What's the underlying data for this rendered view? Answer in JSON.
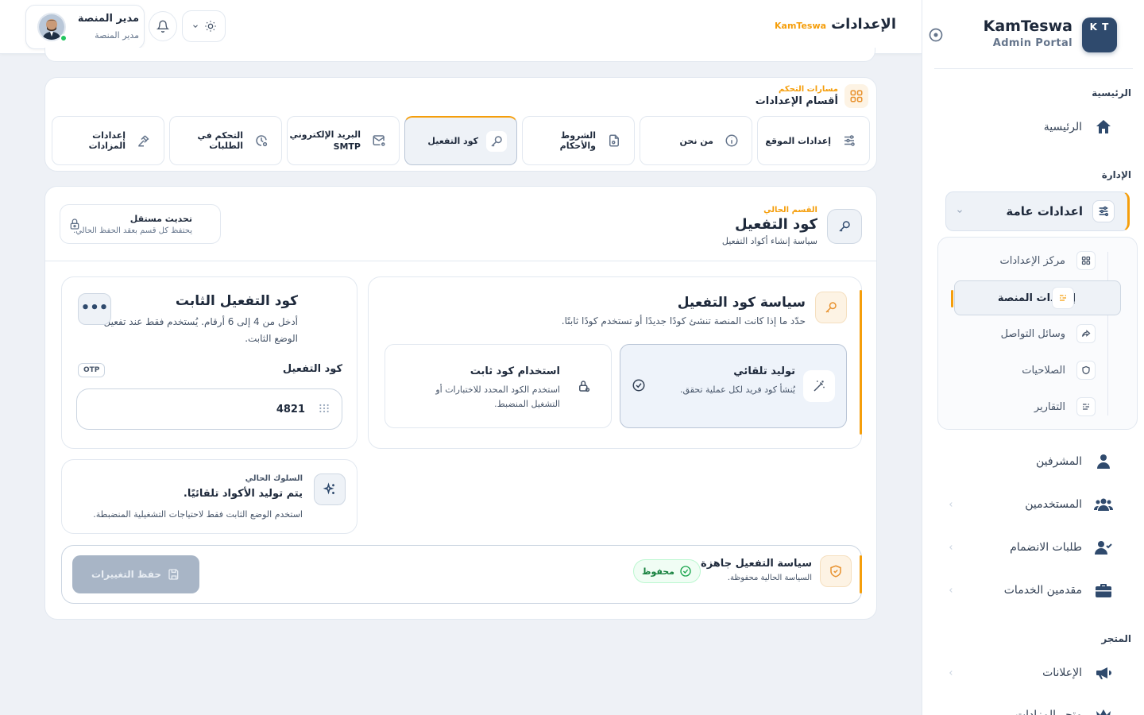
{
  "brand": {
    "logo_text": "K T",
    "name": "KamTeswa",
    "subtitle": "Admin Portal"
  },
  "sidebar": {
    "section_home": "الرئيسية",
    "home_label": "الرئيسية",
    "section_admin": "الإدارة",
    "general_settings_label": "اعدادات عامة",
    "sub_items": [
      {
        "label": "مركز الإعدادات"
      },
      {
        "label": "إعدادات المنصة"
      },
      {
        "label": "وسائل التواصل"
      },
      {
        "label": "الصلاحيات"
      },
      {
        "label": "التقارير"
      }
    ],
    "supervisors_label": "المشرفين",
    "users_label": "المستخدمين",
    "join_requests_label": "طلبات الانضمام",
    "providers_label": "مقدمين الخدمات",
    "section_store": "المتجر",
    "ads_label": "الإعلانات",
    "cut_label": "متجر المزادات"
  },
  "topbar": {
    "title": "الإعدادات",
    "brand_tag": "KamTeswa",
    "user_name": "مدير المنصة",
    "user_role": "مدير المنصة"
  },
  "section_nav": {
    "subtitle": "مسارات التحكم",
    "title": "أقسام الإعدادات",
    "tabs": [
      {
        "label": "إعدادات الموقع",
        "icon": "sliders-icon"
      },
      {
        "label": "من نحن",
        "icon": "info-icon"
      },
      {
        "label": "الشروط والأحكام",
        "icon": "document-icon"
      },
      {
        "label": "كود التفعيل",
        "icon": "key-icon"
      },
      {
        "label": "البريد الإلكتروني SMTP",
        "icon": "mail-settings-icon"
      },
      {
        "label": "التحكم في الطلبات",
        "icon": "clock-settings-icon"
      },
      {
        "label": "إعدادات المزادات",
        "icon": "gavel-icon"
      }
    ]
  },
  "content": {
    "eyebrow": "القسم الحالي",
    "title": "كود التفعيل",
    "description": "سياسة إنشاء أكواد التفعيل",
    "independent_title": "تحديث مستقل",
    "independent_desc": "يحتفظ كل قسم بعقد الحفظ الحالي."
  },
  "policy": {
    "title": "سياسة كود التفعيل",
    "description": "حدّد ما إذا كانت المنصة تنشئ كودًا جديدًا أو تستخدم كودًا ثابتًا.",
    "options": [
      {
        "title": "توليد تلقائي",
        "desc": "يُنشأ كود فريد لكل عملية تحقق.",
        "selected": true
      },
      {
        "title": "استخدام كود ثابت",
        "desc": "استخدم الكود المحدد للاختبارات أو التشغيل المنضبط.",
        "selected": false
      }
    ]
  },
  "fixed_code": {
    "title": "كود التفعيل الثابت",
    "description": "أدخل من 4 إلى 6 أرقام. يُستخدم فقط عند تفعيل الوضع الثابت.",
    "more": "•••",
    "field_label": "كود التفعيل",
    "badge": "OTP",
    "value": "4821"
  },
  "behavior": {
    "eyebrow": "السلوك الحالي",
    "title": "يتم توليد الأكواد تلقائيًا.",
    "desc": "استخدم الوضع الثابت فقط لاحتياجات التشغيلية المنضبطة."
  },
  "save_bar": {
    "title": "سياسة التفعيل جاهزة",
    "desc": "السياسة الحالية محفوظة.",
    "badge": "محفوظ",
    "button": "حفظ التغييرات"
  },
  "colors": {
    "accent": "#f59e0b",
    "primary": "#2f4a6d",
    "success": "#16a34a",
    "background": "#eef1f6"
  }
}
